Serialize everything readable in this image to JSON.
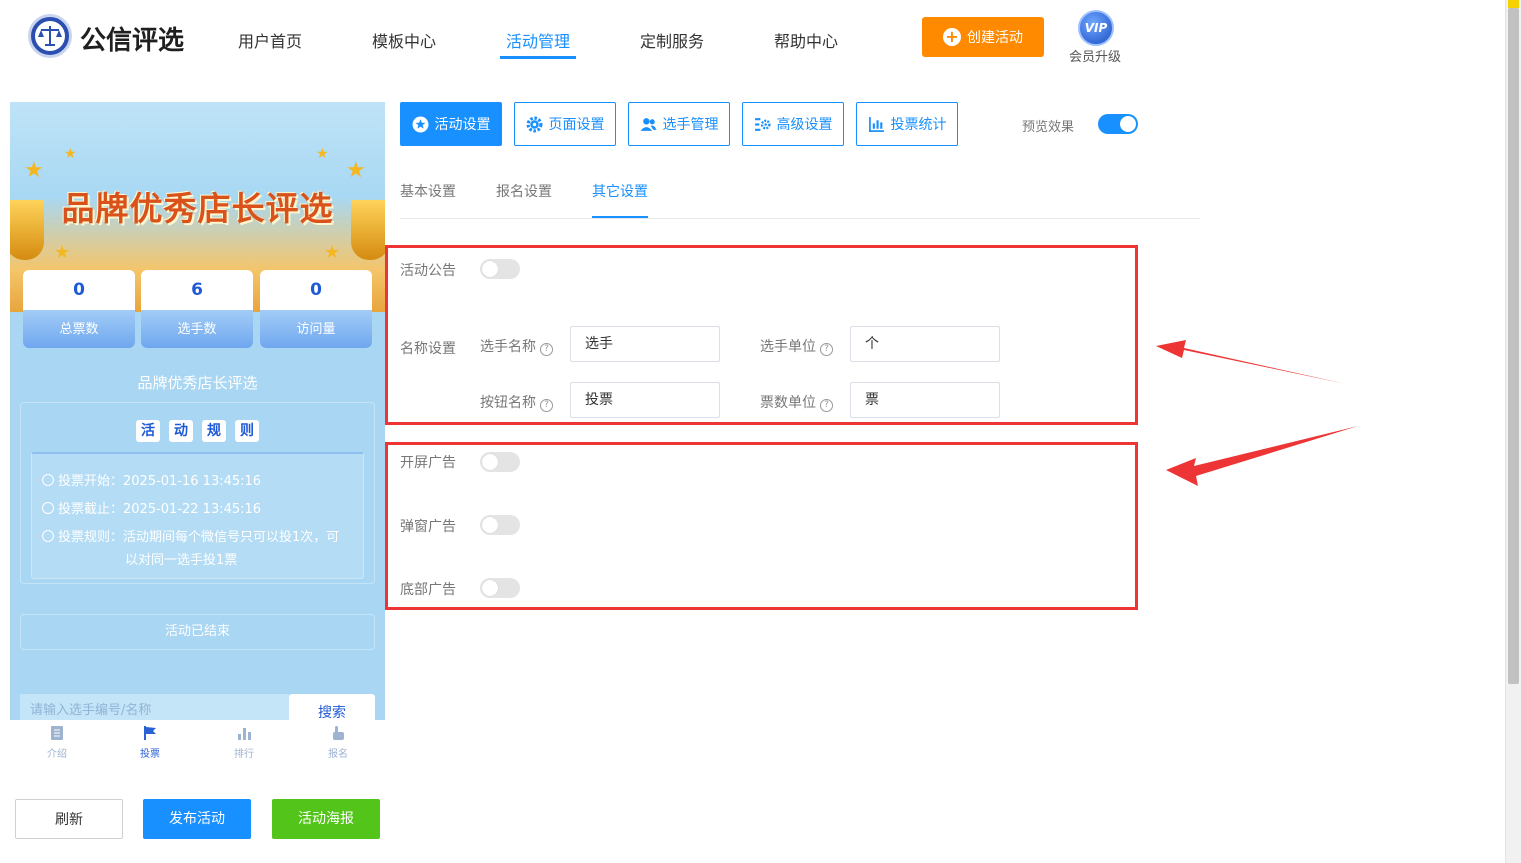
{
  "header": {
    "brand": "公信评选",
    "nav": [
      "用户首页",
      "模板中心",
      "活动管理",
      "定制服务",
      "帮助中心"
    ],
    "active_nav": "活动管理",
    "create_button": "创建活动",
    "vip_badge": "VIP",
    "vip_label": "会员升级"
  },
  "preview": {
    "banner_title": "品牌优秀店长评选",
    "stats": [
      {
        "value": "0",
        "label": "总票数"
      },
      {
        "value": "6",
        "label": "选手数"
      },
      {
        "value": "0",
        "label": "访问量"
      }
    ],
    "activity_name": "品牌优秀店长评选",
    "rules_title": [
      "活",
      "动",
      "规",
      "则"
    ],
    "rules": {
      "start": "投票开始：2025-01-16 13:45:16",
      "end": "投票截止：2025-01-22 13:45:16",
      "rule_line1": "投票规则：活动期间每个微信号只可以投1次，可",
      "rule_line2": "以对同一选手投1票"
    },
    "ended": "活动已结束",
    "search_placeholder": "请输入选手编号/名称",
    "search_button": "搜索",
    "tabbar": [
      {
        "label": "介绍",
        "icon": "document-icon"
      },
      {
        "label": "投票",
        "icon": "flag-icon"
      },
      {
        "label": "排行",
        "icon": "bar-chart-icon"
      },
      {
        "label": "报名",
        "icon": "hand-pointer-icon"
      }
    ],
    "active_tab": "投票"
  },
  "actions": {
    "refresh": "刷新",
    "publish": "发布活动",
    "poster": "活动海报"
  },
  "panel": {
    "tabs": [
      {
        "label": "活动设置",
        "icon": "star-circle-icon"
      },
      {
        "label": "页面设置",
        "icon": "gear-icon"
      },
      {
        "label": "选手管理",
        "icon": "users-icon"
      },
      {
        "label": "高级设置",
        "icon": "settings-list-icon"
      },
      {
        "label": "投票统计",
        "icon": "bar-chart-icon"
      }
    ],
    "active_tab": "活动设置",
    "preview_label": "预览效果",
    "preview_on": true,
    "subtabs": [
      "基本设置",
      "报名设置",
      "其它设置"
    ],
    "active_subtab": "其它设置"
  },
  "form": {
    "announcement_label": "活动公告",
    "announcement_on": false,
    "naming_label": "名称设置",
    "contestant_name_label": "选手名称",
    "contestant_name_value": "选手",
    "contestant_unit_label": "选手单位",
    "contestant_unit_value": "个",
    "button_name_label": "按钮名称",
    "button_name_value": "投票",
    "vote_unit_label": "票数单位",
    "vote_unit_value": "票",
    "splash_ad_label": "开屏广告",
    "splash_ad_on": false,
    "popup_ad_label": "弹窗广告",
    "popup_ad_on": false,
    "bottom_ad_label": "底部广告",
    "bottom_ad_on": false
  },
  "colors": {
    "primary": "#1890ff",
    "orange": "#ff8a00",
    "green": "#52c41a",
    "highlight_red": "#ee3535"
  }
}
